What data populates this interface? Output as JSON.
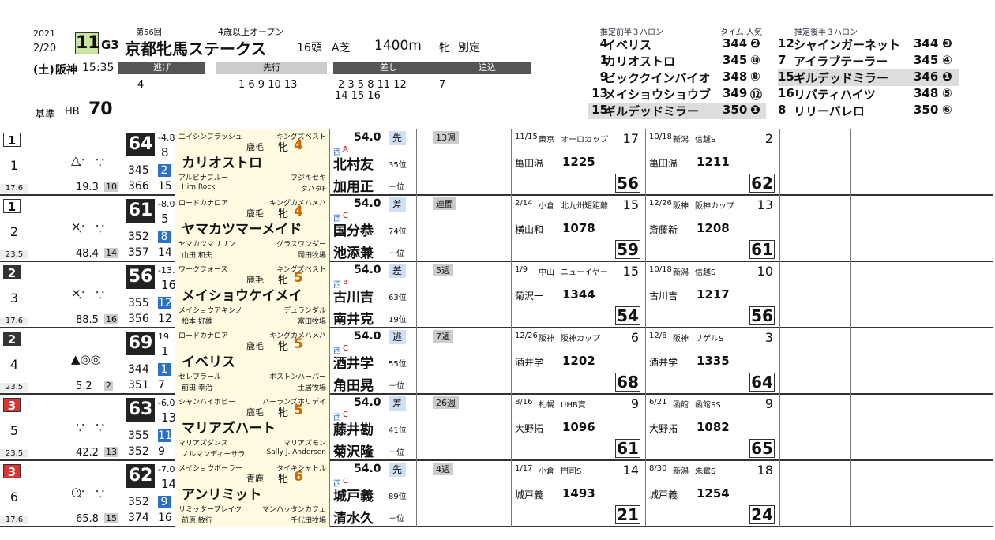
{
  "header": {
    "year": "2021",
    "date": "2/20",
    "day": "(土)",
    "venue": "阪神",
    "time": "15:35",
    "race_no": "11",
    "grade": "G3",
    "edition": "第56回",
    "race_name": "京都牝馬ステークス",
    "conditions": "4歳以上オープン",
    "field": "16頭",
    "course": "A芝",
    "distance": "1400m",
    "sex": "牝",
    "weight_rule": "別定",
    "base_label": "基準",
    "base_hb": "HB",
    "base_value": "70"
  },
  "pace": {
    "nige_label": "逃げ",
    "senko_label": "先行",
    "sashi_label": "差し",
    "oikomi_label": "追込",
    "nige": "4",
    "senko": "1 6 9 10 13",
    "sashi": "2 3 5 8 11 12",
    "sashi2": "14 15 16",
    "oikomi": "7"
  },
  "top3f": {
    "front_title": "推定前半３ハロン",
    "time_title": "タイム 人気",
    "back_title": "推定後半３ハロン",
    "front": [
      {
        "no": "4",
        "name": "イベリス",
        "time": "344",
        "pop": "❷"
      },
      {
        "no": "1",
        "name": "カリオストロ",
        "time": "345",
        "pop": "⑩"
      },
      {
        "no": "9",
        "name": "ビッククインバイオ",
        "time": "348",
        "pop": "⑧"
      },
      {
        "no": "13",
        "name": "メイショウショウブ",
        "time": "349",
        "pop": "⑫"
      },
      {
        "no": "15",
        "name": "ギルデッドミラー",
        "time": "350",
        "pop": "❶"
      }
    ],
    "back": [
      {
        "no": "12",
        "name": "シャインガーネット",
        "time": "344",
        "pop": "❸"
      },
      {
        "no": "7",
        "name": "アイラブテーラー",
        "time": "345",
        "pop": "④"
      },
      {
        "no": "15",
        "name": "ギルデッドミラー",
        "time": "346",
        "pop": "❶"
      },
      {
        "no": "16",
        "name": "リバティハイツ",
        "time": "348",
        "pop": "⑤"
      },
      {
        "no": "8",
        "name": "リリーバレロ",
        "time": "350",
        "pop": "⑥"
      }
    ]
  },
  "horses": [
    {
      "waku": "1",
      "no": "1",
      "odds": "19.3",
      "pop": "10",
      "wt": "17.6",
      "rating": "64",
      "rdiff": "-4.8",
      "r2": "8",
      "t1": "345",
      "t1r": "2",
      "t2": "366",
      "t2r": "15",
      "sire": "エイシンフラッシュ",
      "dam_sire": "キングズベスト",
      "color": "鹿毛",
      "sex": "牝",
      "age": "4",
      "name": "カリオストロ",
      "mark": "△",
      "dam": "アルビナブルー",
      "dam_dam": "フジキセキ",
      "trainer": "Him Rock",
      "owner": "タバタF",
      "weight": "54.0",
      "region": "西",
      "rank_letter": "A",
      "jockey": "北村友",
      "jrank": "35位",
      "trainer2": "加用正",
      "trank": "－位",
      "style": "先",
      "weeks": "13週",
      "past1": {
        "date": "11/15",
        "course": "東京",
        "race": "オーロカップ",
        "place": "17",
        "score": "56",
        "jockey": "亀田温",
        "time": "1225"
      },
      "past2": {
        "date": "10/18",
        "course": "新潟",
        "race": "信越S",
        "place": "2",
        "score": "62",
        "jockey": "亀田温",
        "time": "1211"
      }
    },
    {
      "waku": "1",
      "no": "2",
      "odds": "48.4",
      "pop": "14",
      "wt": "23.5",
      "rating": "61",
      "rdiff": "-8.0",
      "r2": "5",
      "t1": "352",
      "t1r": "8",
      "t2": "357",
      "t2r": "14",
      "sire": "ロードカナロア",
      "dam_sire": "キングカメハメハ",
      "color": "鹿毛",
      "sex": "牝",
      "age": "4",
      "name": "ヤマカツマーメイド",
      "mark": "×",
      "dam": "ヤマカツマリリン",
      "dam_dam": "グラスワンダー",
      "trainer": "山田 和夫",
      "owner": "岡田牧場",
      "weight": "54.0",
      "region": "西",
      "rank_letter": "C",
      "jockey": "国分恭",
      "jrank": "74位",
      "trainer2": "池添兼",
      "trank": "－位",
      "style": "差",
      "weeks": "連闘",
      "past1": {
        "date": "2/14",
        "course": "小倉",
        "race": "北九州短距離",
        "place": "15",
        "score": "59",
        "jockey": "横山和",
        "time": "1078"
      },
      "past2": {
        "date": "12/26",
        "course": "阪神",
        "race": "阪神カップ",
        "place": "13",
        "score": "61",
        "jockey": "斎藤新",
        "time": "1208"
      }
    },
    {
      "waku": "2",
      "no": "3",
      "odds": "88.5",
      "pop": "16",
      "wt": "17.6",
      "rating": "56",
      "rdiff": "-13.0",
      "r2": "16",
      "t1": "355",
      "t1r": "12",
      "t2": "356",
      "t2r": "12",
      "sire": "ワークフォース",
      "dam_sire": "キングズベスト",
      "color": "鹿毛",
      "sex": "牝",
      "age": "5",
      "name": "メイショウケイメイ",
      "mark": "×",
      "dam": "メイショウアキシノ",
      "dam_dam": "デュランダル",
      "trainer": "松本 好雄",
      "owner": "富田牧場",
      "weight": "54.0",
      "region": "西",
      "rank_letter": "B",
      "jockey": "古川吉",
      "jrank": "63位",
      "trainer2": "南井克",
      "trank": "19位",
      "style": "差",
      "weeks": "5週",
      "past1": {
        "date": "1/9",
        "course": "中山",
        "race": "ニューイヤー",
        "place": "15",
        "score": "54",
        "jockey": "菊沢一",
        "time": "1344"
      },
      "past2": {
        "date": "10/18",
        "course": "新潟",
        "race": "信越S",
        "place": "10",
        "score": "56",
        "jockey": "古川吉",
        "time": "1217"
      }
    },
    {
      "waku": "2",
      "no": "4",
      "odds": "5.2",
      "pop": "2",
      "wt": "23.5",
      "rating": "69",
      "rdiff": "19",
      "r2": "1",
      "t1": "344",
      "t1r": "1",
      "t2": "351",
      "t2r": "7",
      "sire": "ロードカナロア",
      "dam_sire": "キングカメハメハ",
      "color": "鹿毛",
      "sex": "牝",
      "age": "5",
      "name": "イベリス",
      "mark": "▲◎◎",
      "dam": "セレブラール",
      "dam_dam": "ボストンハーバー",
      "trainer": "前田 幸治",
      "owner": "土居牧場",
      "weight": "54.0",
      "region": "西",
      "rank_letter": "C",
      "jockey": "酒井学",
      "jrank": "55位",
      "trainer2": "角田晃",
      "trank": "－位",
      "style": "逃",
      "weeks": "7週",
      "past1": {
        "date": "12/26",
        "course": "阪神",
        "race": "阪神カップ",
        "place": "6",
        "score": "68",
        "jockey": "酒井学",
        "time": "1202"
      },
      "past2": {
        "date": "12/6",
        "course": "阪神",
        "race": "リゲルS",
        "place": "3",
        "score": "64",
        "jockey": "酒井学",
        "time": "1335"
      }
    },
    {
      "waku": "3",
      "no": "5",
      "odds": "42.2",
      "pop": "13",
      "wt": "23.5",
      "rating": "63",
      "rdiff": "-6.0",
      "r2": "13",
      "t1": "355",
      "t1r": "11",
      "t2": "352",
      "t2r": "9",
      "sire": "シャンハイボビー",
      "dam_sire": "ハーランズホリデイ",
      "color": "鹿毛",
      "sex": "牝",
      "age": "5",
      "name": "マリアズハート",
      "mark": "",
      "dam": "マリアズダンス",
      "dam_dam": "マリアズモン",
      "trainer": "ノルマンディーサラ",
      "owner": "Sally J. Andersen",
      "weight": "54.0",
      "region": "西",
      "rank_letter": "C",
      "jockey": "藤井勘",
      "jrank": "41位",
      "trainer2": "菊沢隆",
      "trank": "－位",
      "style": "差",
      "weeks": "26週",
      "past1": {
        "date": "8/16",
        "course": "札幌",
        "race": "UHB賞",
        "place": "9",
        "score": "61",
        "jockey": "大野拓",
        "time": "1096"
      },
      "past2": {
        "date": "6/21",
        "course": "函館",
        "race": "函館SS",
        "place": "9",
        "score": "65",
        "jockey": "大野拓",
        "time": "1082"
      }
    },
    {
      "waku": "3",
      "no": "6",
      "odds": "65.8",
      "pop": "15",
      "wt": "17.6",
      "rating": "62",
      "rdiff": "-7.0",
      "r2": "14",
      "t1": "352",
      "t1r": "9",
      "t2": "374",
      "t2r": "16",
      "sire": "メイショウボーラー",
      "dam_sire": "タイキシャトル",
      "color": "青鹿",
      "sex": "牝",
      "age": "6",
      "name": "アンリミット",
      "mark": "○",
      "dam": "リミッターブレイク",
      "dam_dam": "マンハッタンカフェ",
      "trainer": "前原 敏行",
      "owner": "千代田牧場",
      "weight": "54.0",
      "region": "西",
      "rank_letter": "C",
      "jockey": "城戸義",
      "jrank": "89位",
      "trainer2": "清水久",
      "trank": "－位",
      "style": "先",
      "weeks": "4週",
      "past1": {
        "date": "1/17",
        "course": "小倉",
        "race": "門司S",
        "place": "14",
        "score": "21",
        "jockey": "城戸義",
        "time": "1493"
      },
      "past2": {
        "date": "8/30",
        "course": "新潟",
        "race": "朱鷺S",
        "place": "18",
        "score": "24",
        "jockey": "城戸義",
        "time": "1254"
      }
    }
  ]
}
